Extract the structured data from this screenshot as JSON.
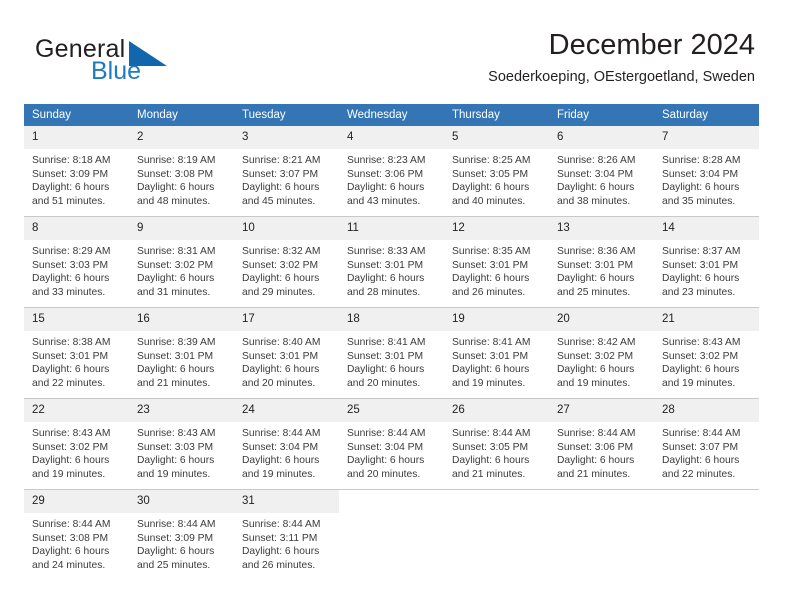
{
  "brand": {
    "name_part1": "General",
    "name_part2": "Blue",
    "triangle_color": "#1266ad",
    "blue_text_color": "#1f7bc1"
  },
  "header": {
    "title": "December 2024",
    "subtitle": "Soederkoeping, OEstergoetland, Sweden"
  },
  "theme": {
    "header_row_bg": "#3476b5",
    "daynum_bg": "#f0f0f0",
    "grid_line": "#c9c9c9",
    "accent_line": "#1f6cb0",
    "text": "#231f20"
  },
  "weekday_headers": [
    "Sunday",
    "Monday",
    "Tuesday",
    "Wednesday",
    "Thursday",
    "Friday",
    "Saturday"
  ],
  "weeks": [
    [
      {
        "day": "1",
        "sunrise": "Sunrise: 8:18 AM",
        "sunset": "Sunset: 3:09 PM",
        "daylight1": "Daylight: 6 hours",
        "daylight2": "and 51 minutes."
      },
      {
        "day": "2",
        "sunrise": "Sunrise: 8:19 AM",
        "sunset": "Sunset: 3:08 PM",
        "daylight1": "Daylight: 6 hours",
        "daylight2": "and 48 minutes."
      },
      {
        "day": "3",
        "sunrise": "Sunrise: 8:21 AM",
        "sunset": "Sunset: 3:07 PM",
        "daylight1": "Daylight: 6 hours",
        "daylight2": "and 45 minutes."
      },
      {
        "day": "4",
        "sunrise": "Sunrise: 8:23 AM",
        "sunset": "Sunset: 3:06 PM",
        "daylight1": "Daylight: 6 hours",
        "daylight2": "and 43 minutes."
      },
      {
        "day": "5",
        "sunrise": "Sunrise: 8:25 AM",
        "sunset": "Sunset: 3:05 PM",
        "daylight1": "Daylight: 6 hours",
        "daylight2": "and 40 minutes."
      },
      {
        "day": "6",
        "sunrise": "Sunrise: 8:26 AM",
        "sunset": "Sunset: 3:04 PM",
        "daylight1": "Daylight: 6 hours",
        "daylight2": "and 38 minutes."
      },
      {
        "day": "7",
        "sunrise": "Sunrise: 8:28 AM",
        "sunset": "Sunset: 3:04 PM",
        "daylight1": "Daylight: 6 hours",
        "daylight2": "and 35 minutes."
      }
    ],
    [
      {
        "day": "8",
        "sunrise": "Sunrise: 8:29 AM",
        "sunset": "Sunset: 3:03 PM",
        "daylight1": "Daylight: 6 hours",
        "daylight2": "and 33 minutes."
      },
      {
        "day": "9",
        "sunrise": "Sunrise: 8:31 AM",
        "sunset": "Sunset: 3:02 PM",
        "daylight1": "Daylight: 6 hours",
        "daylight2": "and 31 minutes."
      },
      {
        "day": "10",
        "sunrise": "Sunrise: 8:32 AM",
        "sunset": "Sunset: 3:02 PM",
        "daylight1": "Daylight: 6 hours",
        "daylight2": "and 29 minutes."
      },
      {
        "day": "11",
        "sunrise": "Sunrise: 8:33 AM",
        "sunset": "Sunset: 3:01 PM",
        "daylight1": "Daylight: 6 hours",
        "daylight2": "and 28 minutes."
      },
      {
        "day": "12",
        "sunrise": "Sunrise: 8:35 AM",
        "sunset": "Sunset: 3:01 PM",
        "daylight1": "Daylight: 6 hours",
        "daylight2": "and 26 minutes."
      },
      {
        "day": "13",
        "sunrise": "Sunrise: 8:36 AM",
        "sunset": "Sunset: 3:01 PM",
        "daylight1": "Daylight: 6 hours",
        "daylight2": "and 25 minutes."
      },
      {
        "day": "14",
        "sunrise": "Sunrise: 8:37 AM",
        "sunset": "Sunset: 3:01 PM",
        "daylight1": "Daylight: 6 hours",
        "daylight2": "and 23 minutes."
      }
    ],
    [
      {
        "day": "15",
        "sunrise": "Sunrise: 8:38 AM",
        "sunset": "Sunset: 3:01 PM",
        "daylight1": "Daylight: 6 hours",
        "daylight2": "and 22 minutes."
      },
      {
        "day": "16",
        "sunrise": "Sunrise: 8:39 AM",
        "sunset": "Sunset: 3:01 PM",
        "daylight1": "Daylight: 6 hours",
        "daylight2": "and 21 minutes."
      },
      {
        "day": "17",
        "sunrise": "Sunrise: 8:40 AM",
        "sunset": "Sunset: 3:01 PM",
        "daylight1": "Daylight: 6 hours",
        "daylight2": "and 20 minutes."
      },
      {
        "day": "18",
        "sunrise": "Sunrise: 8:41 AM",
        "sunset": "Sunset: 3:01 PM",
        "daylight1": "Daylight: 6 hours",
        "daylight2": "and 20 minutes."
      },
      {
        "day": "19",
        "sunrise": "Sunrise: 8:41 AM",
        "sunset": "Sunset: 3:01 PM",
        "daylight1": "Daylight: 6 hours",
        "daylight2": "and 19 minutes."
      },
      {
        "day": "20",
        "sunrise": "Sunrise: 8:42 AM",
        "sunset": "Sunset: 3:02 PM",
        "daylight1": "Daylight: 6 hours",
        "daylight2": "and 19 minutes."
      },
      {
        "day": "21",
        "sunrise": "Sunrise: 8:43 AM",
        "sunset": "Sunset: 3:02 PM",
        "daylight1": "Daylight: 6 hours",
        "daylight2": "and 19 minutes."
      }
    ],
    [
      {
        "day": "22",
        "sunrise": "Sunrise: 8:43 AM",
        "sunset": "Sunset: 3:02 PM",
        "daylight1": "Daylight: 6 hours",
        "daylight2": "and 19 minutes."
      },
      {
        "day": "23",
        "sunrise": "Sunrise: 8:43 AM",
        "sunset": "Sunset: 3:03 PM",
        "daylight1": "Daylight: 6 hours",
        "daylight2": "and 19 minutes."
      },
      {
        "day": "24",
        "sunrise": "Sunrise: 8:44 AM",
        "sunset": "Sunset: 3:04 PM",
        "daylight1": "Daylight: 6 hours",
        "daylight2": "and 19 minutes."
      },
      {
        "day": "25",
        "sunrise": "Sunrise: 8:44 AM",
        "sunset": "Sunset: 3:04 PM",
        "daylight1": "Daylight: 6 hours",
        "daylight2": "and 20 minutes."
      },
      {
        "day": "26",
        "sunrise": "Sunrise: 8:44 AM",
        "sunset": "Sunset: 3:05 PM",
        "daylight1": "Daylight: 6 hours",
        "daylight2": "and 21 minutes."
      },
      {
        "day": "27",
        "sunrise": "Sunrise: 8:44 AM",
        "sunset": "Sunset: 3:06 PM",
        "daylight1": "Daylight: 6 hours",
        "daylight2": "and 21 minutes."
      },
      {
        "day": "28",
        "sunrise": "Sunrise: 8:44 AM",
        "sunset": "Sunset: 3:07 PM",
        "daylight1": "Daylight: 6 hours",
        "daylight2": "and 22 minutes."
      }
    ],
    [
      {
        "day": "29",
        "sunrise": "Sunrise: 8:44 AM",
        "sunset": "Sunset: 3:08 PM",
        "daylight1": "Daylight: 6 hours",
        "daylight2": "and 24 minutes."
      },
      {
        "day": "30",
        "sunrise": "Sunrise: 8:44 AM",
        "sunset": "Sunset: 3:09 PM",
        "daylight1": "Daylight: 6 hours",
        "daylight2": "and 25 minutes."
      },
      {
        "day": "31",
        "sunrise": "Sunrise: 8:44 AM",
        "sunset": "Sunset: 3:11 PM",
        "daylight1": "Daylight: 6 hours",
        "daylight2": "and 26 minutes."
      },
      {
        "day": "",
        "sunrise": "",
        "sunset": "",
        "daylight1": "",
        "daylight2": ""
      },
      {
        "day": "",
        "sunrise": "",
        "sunset": "",
        "daylight1": "",
        "daylight2": ""
      },
      {
        "day": "",
        "sunrise": "",
        "sunset": "",
        "daylight1": "",
        "daylight2": ""
      },
      {
        "day": "",
        "sunrise": "",
        "sunset": "",
        "daylight1": "",
        "daylight2": ""
      }
    ]
  ]
}
